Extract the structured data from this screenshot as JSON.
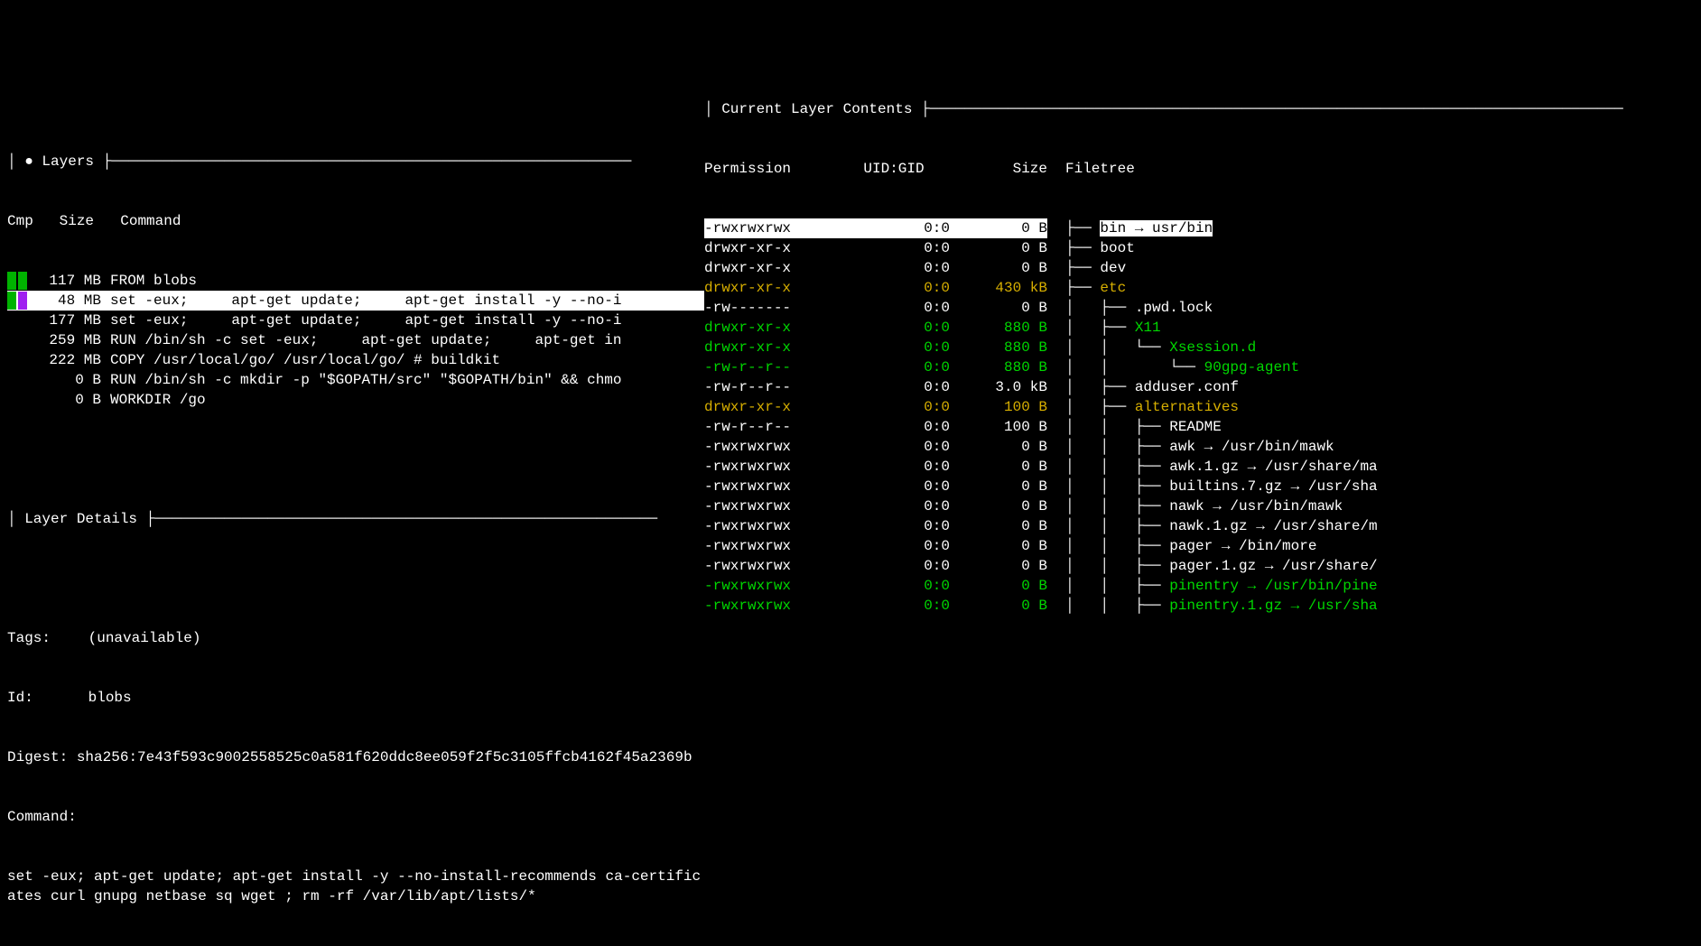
{
  "left": {
    "layers_title": "● Layers",
    "layers_header": {
      "cmp": "Cmp",
      "size": "Size",
      "command": "Command"
    },
    "layers": [
      {
        "cmp": [
          "green",
          "green"
        ],
        "size": "117 MB",
        "command": "FROM blobs",
        "selected": false
      },
      {
        "cmp": [
          "green",
          "purple"
        ],
        "size": "48 MB",
        "command": "set -eux;     apt-get update;     apt-get install -y --no-i",
        "selected": true
      },
      {
        "cmp": [],
        "size": "177 MB",
        "command": "set -eux;     apt-get update;     apt-get install -y --no-i",
        "selected": false
      },
      {
        "cmp": [],
        "size": "259 MB",
        "command": "RUN /bin/sh -c set -eux;     apt-get update;     apt-get in",
        "selected": false
      },
      {
        "cmp": [],
        "size": "222 MB",
        "command": "COPY /usr/local/go/ /usr/local/go/ # buildkit",
        "selected": false
      },
      {
        "cmp": [],
        "size": "0 B",
        "command": "RUN /bin/sh -c mkdir -p \"$GOPATH/src\" \"$GOPATH/bin\" && chmo",
        "selected": false
      },
      {
        "cmp": [],
        "size": "0 B",
        "command": "WORKDIR /go",
        "selected": false
      }
    ],
    "details_title": "Layer Details",
    "details": {
      "tags_label": "Tags:",
      "tags_value": "(unavailable)",
      "id_label": "Id:",
      "id_value": "blobs",
      "digest_label": "Digest:",
      "digest_value": "sha256:7e43f593c9002558525c0a581f620ddc8ee059f2f5c3105ffcb4162f45a2369b",
      "command_label": "Command:",
      "command_value": "set -eux;     apt-get update;     apt-get install -y --no-install-recommends       ca-certificates       curl       gnupg       netbase       sq       wget     ;     rm -rf /var/lib/apt/lists/*"
    }
  },
  "right": {
    "title": "Current Layer Contents",
    "header": {
      "permission": "Permission",
      "uidgid": "UID:GID",
      "size": "Size",
      "filetree": "Filetree"
    },
    "rows": [
      {
        "perm": "-rwxrwxrwx",
        "uidgid": "0:0",
        "size": "0 B",
        "tree_prefix": "├── ",
        "name": "bin → usr/bin",
        "color": "white",
        "highlighted": true,
        "indent": 0
      },
      {
        "perm": "drwxr-xr-x",
        "uidgid": "0:0",
        "size": "0 B",
        "tree_prefix": "├── ",
        "name": "boot",
        "color": "white",
        "indent": 0
      },
      {
        "perm": "drwxr-xr-x",
        "uidgid": "0:0",
        "size": "0 B",
        "tree_prefix": "├── ",
        "name": "dev",
        "color": "white",
        "indent": 0
      },
      {
        "perm": "drwxr-xr-x",
        "uidgid": "0:0",
        "size": "430 kB",
        "tree_prefix": "├── ",
        "name": "etc",
        "color": "yellow",
        "indent": 0
      },
      {
        "perm": "-rw-------",
        "uidgid": "0:0",
        "size": "0 B",
        "tree_prefix": "│   ├── ",
        "name": ".pwd.lock",
        "color": "white",
        "indent": 1
      },
      {
        "perm": "drwxr-xr-x",
        "uidgid": "0:0",
        "size": "880 B",
        "tree_prefix": "│   ├── ",
        "name": "X11",
        "color": "green",
        "indent": 1
      },
      {
        "perm": "drwxr-xr-x",
        "uidgid": "0:0",
        "size": "880 B",
        "tree_prefix": "│   │   └── ",
        "name": "Xsession.d",
        "color": "green",
        "indent": 2
      },
      {
        "perm": "-rw-r--r--",
        "uidgid": "0:0",
        "size": "880 B",
        "tree_prefix": "│   │       └── ",
        "name": "90gpg-agent",
        "color": "green",
        "indent": 3
      },
      {
        "perm": "-rw-r--r--",
        "uidgid": "0:0",
        "size": "3.0 kB",
        "tree_prefix": "│   ├── ",
        "name": "adduser.conf",
        "color": "white",
        "indent": 1
      },
      {
        "perm": "drwxr-xr-x",
        "uidgid": "0:0",
        "size": "100 B",
        "tree_prefix": "│   ├── ",
        "name": "alternatives",
        "color": "yellow",
        "indent": 1
      },
      {
        "perm": "-rw-r--r--",
        "uidgid": "0:0",
        "size": "100 B",
        "tree_prefix": "│   │   ├── ",
        "name": "README",
        "color": "white",
        "indent": 2
      },
      {
        "perm": "-rwxrwxrwx",
        "uidgid": "0:0",
        "size": "0 B",
        "tree_prefix": "│   │   ├── ",
        "name": "awk → /usr/bin/mawk",
        "color": "white",
        "indent": 2
      },
      {
        "perm": "-rwxrwxrwx",
        "uidgid": "0:0",
        "size": "0 B",
        "tree_prefix": "│   │   ├── ",
        "name": "awk.1.gz → /usr/share/ma",
        "color": "white",
        "indent": 2
      },
      {
        "perm": "-rwxrwxrwx",
        "uidgid": "0:0",
        "size": "0 B",
        "tree_prefix": "│   │   ├── ",
        "name": "builtins.7.gz → /usr/sha",
        "color": "white",
        "indent": 2
      },
      {
        "perm": "-rwxrwxrwx",
        "uidgid": "0:0",
        "size": "0 B",
        "tree_prefix": "│   │   ├── ",
        "name": "nawk → /usr/bin/mawk",
        "color": "white",
        "indent": 2
      },
      {
        "perm": "-rwxrwxrwx",
        "uidgid": "0:0",
        "size": "0 B",
        "tree_prefix": "│   │   ├── ",
        "name": "nawk.1.gz → /usr/share/m",
        "color": "white",
        "indent": 2
      },
      {
        "perm": "-rwxrwxrwx",
        "uidgid": "0:0",
        "size": "0 B",
        "tree_prefix": "│   │   ├── ",
        "name": "pager → /bin/more",
        "color": "white",
        "indent": 2
      },
      {
        "perm": "-rwxrwxrwx",
        "uidgid": "0:0",
        "size": "0 B",
        "tree_prefix": "│   │   ├── ",
        "name": "pager.1.gz → /usr/share/",
        "color": "white",
        "indent": 2
      },
      {
        "perm": "-rwxrwxrwx",
        "uidgid": "0:0",
        "size": "0 B",
        "tree_prefix": "│   │   ├── ",
        "name": "pinentry → /usr/bin/pine",
        "color": "green",
        "indent": 2
      },
      {
        "perm": "-rwxrwxrwx",
        "uidgid": "0:0",
        "size": "0 B",
        "tree_prefix": "│   │   ├── ",
        "name": "pinentry.1.gz → /usr/sha",
        "color": "green",
        "indent": 2
      }
    ]
  }
}
